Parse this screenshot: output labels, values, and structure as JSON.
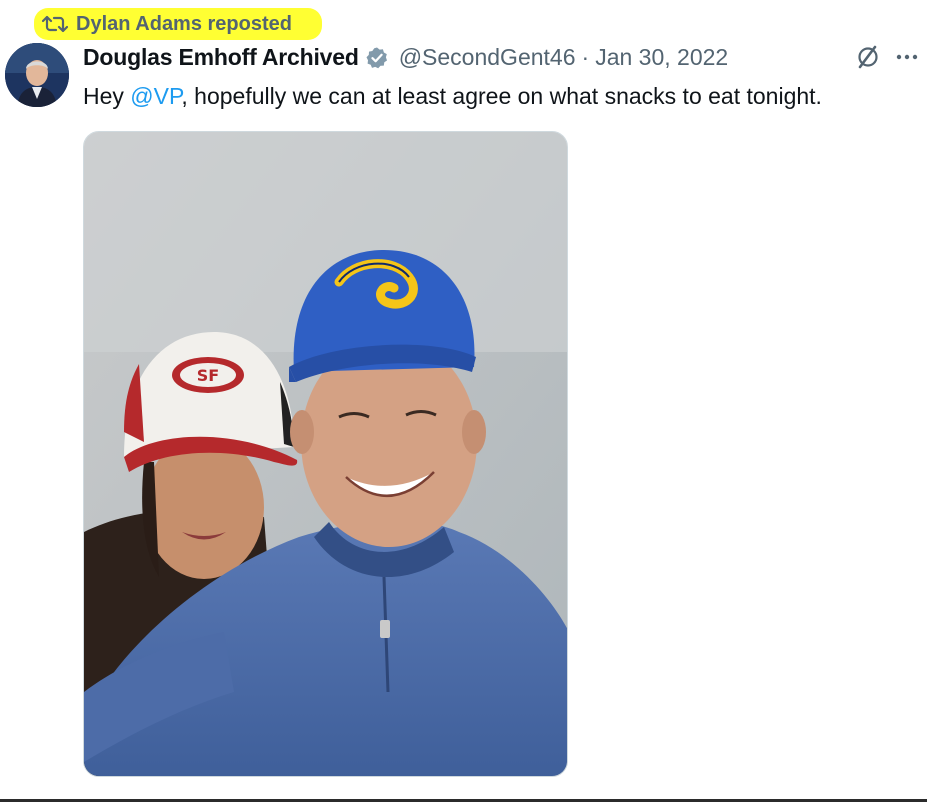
{
  "repost": {
    "icon": "repost-icon",
    "text": "Dylan Adams reposted",
    "highlight_color": "#ffff33"
  },
  "tweet": {
    "avatar_icon": "avatar",
    "display_name": "Douglas Emhoff Archived",
    "verified_icon": "verified-badge-icon",
    "verified_color": "#829aab",
    "handle": "@SecondGent46",
    "separator": "·",
    "date": "Jan 30, 2022",
    "text_before": "Hey ",
    "mention": "@VP",
    "text_after": ", hopefully we can at least agree on what snacks to eat tonight.",
    "mention_color": "#1d9bf0",
    "media_icon": "selfie-photo"
  },
  "actions": {
    "grok_icon": "grok-icon",
    "more_icon": "more-icon"
  }
}
